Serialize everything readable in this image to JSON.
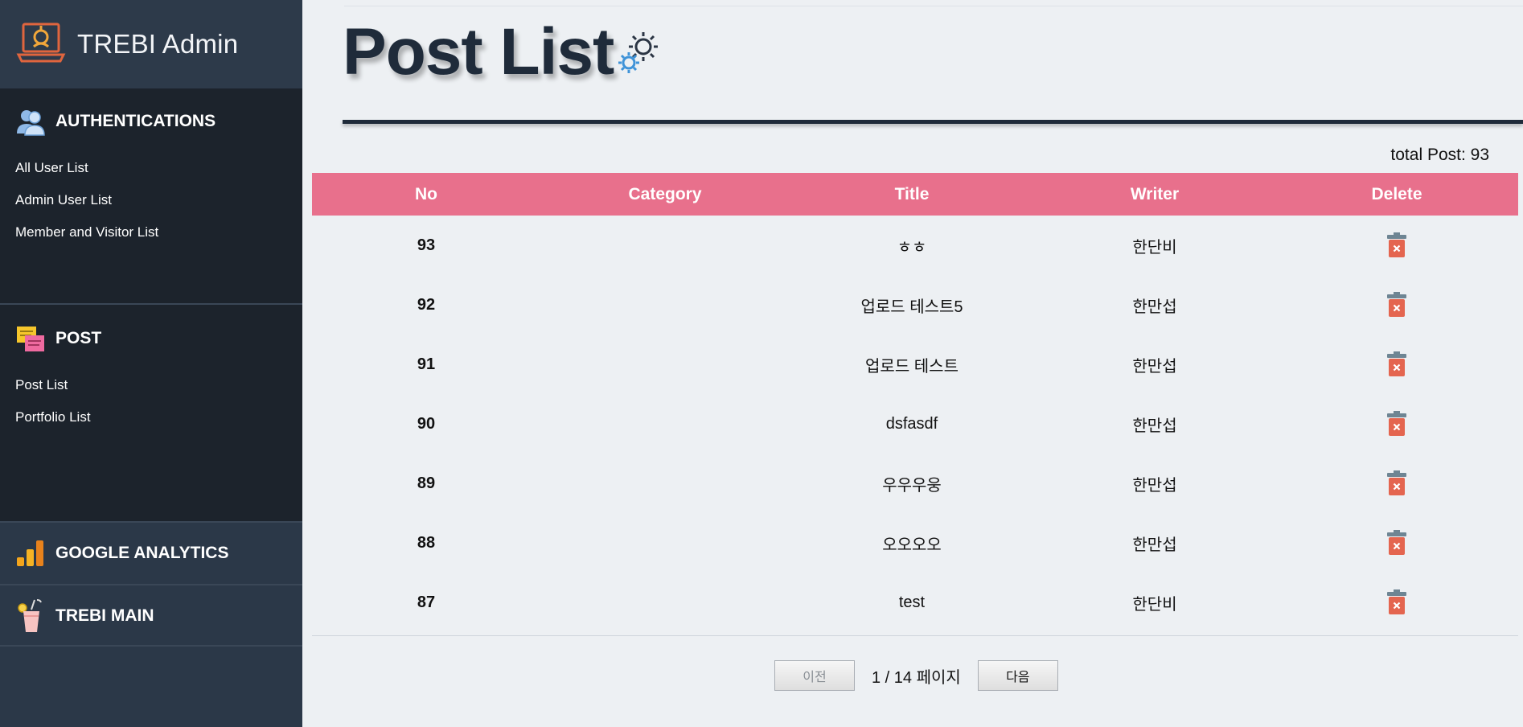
{
  "sidebar": {
    "brand": "TREBI Admin",
    "sections": [
      {
        "title": "AUTHENTICATIONS",
        "icon": "users-icon",
        "items": [
          "All User List",
          "Admin User List",
          "Member and Visitor List"
        ]
      },
      {
        "title": "POST",
        "icon": "sticky-notes-icon",
        "items": [
          "Post List",
          "Portfolio List"
        ]
      },
      {
        "title": "GOOGLE ANALYTICS",
        "icon": "analytics-bars-icon",
        "items": []
      },
      {
        "title": "TREBI MAIN",
        "icon": "drink-icon",
        "items": []
      }
    ]
  },
  "page": {
    "title": "Post List",
    "total_label": "total Post: 93"
  },
  "table": {
    "columns": [
      "No",
      "Category",
      "Title",
      "Writer",
      "Delete"
    ],
    "rows": [
      {
        "no": "93",
        "category": "",
        "title": "ㅎㅎ",
        "writer": "한단비"
      },
      {
        "no": "92",
        "category": "",
        "title": "업로드 테스트5",
        "writer": "한만섭"
      },
      {
        "no": "91",
        "category": "",
        "title": "업로드 테스트",
        "writer": "한만섭"
      },
      {
        "no": "90",
        "category": "",
        "title": "dsfasdf",
        "writer": "한만섭"
      },
      {
        "no": "89",
        "category": "",
        "title": "우우우웅",
        "writer": "한만섭"
      },
      {
        "no": "88",
        "category": "",
        "title": "오오오오",
        "writer": "한만섭"
      },
      {
        "no": "87",
        "category": "",
        "title": "test",
        "writer": "한단비"
      }
    ]
  },
  "pagination": {
    "prev_label": "이전",
    "info": "1 / 14 페이지",
    "next_label": "다음"
  },
  "colors": {
    "header_row": "#e8708c",
    "sidebar_bg": "#1c232c",
    "sidebar_brand_bg": "#2d3a4a",
    "trash": "#e4654f"
  }
}
